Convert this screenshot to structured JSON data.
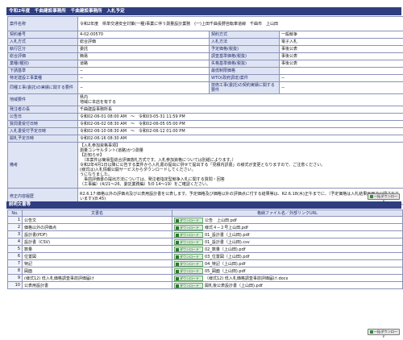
{
  "page": {
    "title": "令和2年度　千曲建設事務所　千曲建設事務所　入札予定"
  },
  "info": {
    "jigyo_name_label": "案件名称",
    "jigyo_name_value": "令和2年度　県単交通安全対策(一種)事業に伴う測量設計業務　(一)上田千曲長野自転車道線　千曲市　上山田",
    "row_a": {
      "l1": "契約番号",
      "v1": "4-02-00570",
      "l2": "契約方式",
      "v2": "一般競争"
    },
    "row_b": {
      "l1": "入札方式",
      "v1": "総合評価",
      "l2": "入札方法",
      "v2": "電子入札"
    },
    "row_c": {
      "l1": "執行区分",
      "v1": "委託",
      "l2": "予定価格(税抜)",
      "v2": "事後公表"
    },
    "row_d": {
      "l1": "総合評価",
      "v1": "簡易",
      "l2": "調査基準価格(税抜)",
      "v2": "事後公表"
    },
    "row_e": {
      "l1": "業種(種別)",
      "v1": "道路",
      "l2": "失格基準価格(税抜)",
      "v2": "事後公表"
    },
    "row_f": {
      "l1": "下請基準",
      "v1": "−",
      "l2": "最低制限価格",
      "v2": ""
    },
    "row_g": {
      "l1": "特定建設工事業種",
      "v1": "−",
      "l2": "WTO(政府調達)案件",
      "v2": "−"
    },
    "row_h": {
      "l1": "同種工事(委託)の実績に関する要件",
      "v1": "−",
      "l2": "技術工事(委託)の契約実績に関する要件",
      "v2": "−"
    },
    "row_i": {
      "l1": "地域要件",
      "v1a": "県内",
      "v1b": "地域に本店を有する"
    },
    "row_j": {
      "l1": "発注者の長",
      "v1": "千曲建設事務所長"
    },
    "row_k": {
      "l1": "公告日",
      "v1": "令和02-06-01 08:00 AM　〜　令和03-05-31 11:59 PM"
    },
    "row_l": {
      "l1": "質問書受付日時",
      "v1": "令和02-06-02 08:30 AM　〜　令和02-06-05 05:00 PM"
    },
    "row_m": {
      "l1": "入札書受付予定日時",
      "v1": "令和02-06-10 08:30 AM　〜　令和02-06-12 01:00 PM"
    },
    "row_n": {
      "l1": "開札予定日時",
      "v1": "令和02-06-16 08:30 AM"
    },
    "remarks_label": "備考",
    "remarks_lines": [
      "【入札参加資格事項】",
      "測量コンサルタント(道路)かつ測量",
      "【お知らせ】",
      "　（本案件は簡易型総合評価落札方式です。入札参加資格については別紙によります。）",
      "令和2年4月1日以降に公告する案件から入札書の提出に併せて提出する「見積内訳書」の様式が変更となりますので、ご注意ください。",
      "(様式は)入札情報公開サービスからダウンロードしてください。",
      "うになりました。",
      "　事前評価書の提出方法については、発注者指定型競争入札に関する質問・回答",
      "（工事編）(4/21〜26、委託業務編）5/0 14〜19）をご確認ください。"
    ],
    "correction_label": "修正内容履歴",
    "correction_lines": [
      "R2.6.17:価格以外の評価点及び公表用設計書を公表します。予定価格及び価格以外の評価点に付する結果等は、R2.6.18(木)正午までに、（予定価格は入札結果画面で公開されています)(8:45)"
    ]
  },
  "buttons": {
    "top": "一括ダウンロード",
    "bottom": "一括ダウンロード"
  },
  "docs_section": {
    "title": "説明文書等"
  },
  "docs": {
    "headers": {
      "no": "No.",
      "name": "文書名",
      "file": "格納ファイル名／外部リンクURL"
    },
    "download_label": "ダウンロード",
    "rows": [
      {
        "no": "1",
        "name": "公告文",
        "file": "公告　上山田.pdf"
      },
      {
        "no": "2",
        "name": "価格以外の評価点",
        "file": "様式４−２号上山田.pdf"
      },
      {
        "no": "3",
        "name": "設計書(PDF)",
        "file": "01_設計書（上山田).pdf"
      },
      {
        "no": "4",
        "name": "設計書（CSV)",
        "file": "01_設計書（上山田).csv"
      },
      {
        "no": "5",
        "name": "数量",
        "file": "02_数量（上山田).pdf"
      },
      {
        "no": "6",
        "name": "位置図",
        "file": "03_位置図（上山田).pdf"
      },
      {
        "no": "7",
        "name": "特記",
        "file": "04_特記（上山田).pdf"
      },
      {
        "no": "8",
        "name": "図面",
        "file": "05_図面（上山田).pdf"
      },
      {
        "no": "9",
        "name": "(様式12) 低入札価格調査事前評価届け",
        "file": "（様式12) 低入札価格調査事前評価届け.docx"
      },
      {
        "no": "10",
        "name": "公表用設計書",
        "file": "開札後公表設計書（上山田).pdf"
      }
    ]
  }
}
